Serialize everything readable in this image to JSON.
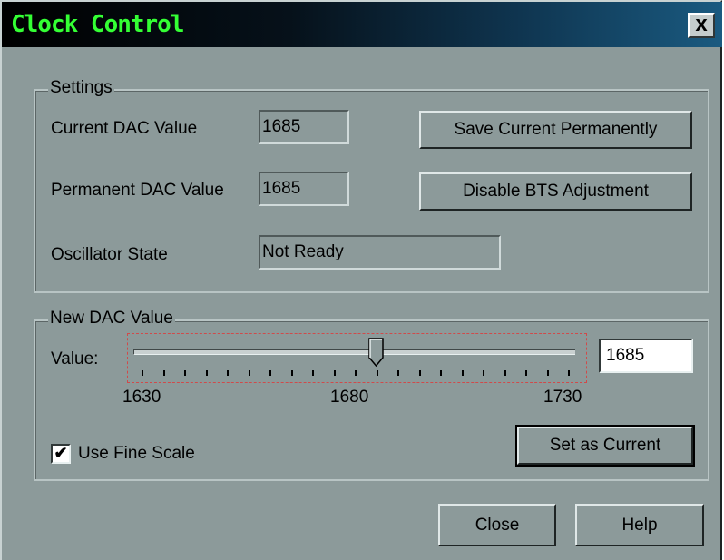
{
  "window": {
    "title": "Clock Control",
    "close_glyph": "x"
  },
  "settings": {
    "legend": "Settings",
    "current_dac_label": "Current DAC Value",
    "current_dac_value": "1685",
    "permanent_dac_label": "Permanent DAC Value",
    "permanent_dac_value": "1685",
    "oscillator_label": "Oscillator State",
    "oscillator_value": "Not Ready",
    "save_button": "Save Current Permanently",
    "disable_button": "Disable BTS Adjustment"
  },
  "new_dac": {
    "legend": "New DAC Value",
    "value_label": "Value:",
    "slider": {
      "min": 1630,
      "max": 1730,
      "value": 1685,
      "tick_count": 21
    },
    "tick_labels": [
      "1630",
      "1680",
      "1730"
    ],
    "input_value": "1685",
    "fine_scale_label": "Use Fine Scale",
    "fine_scale_checked": true,
    "check_glyph": "✔",
    "set_current_button": "Set as Current"
  },
  "footer": {
    "close_button": "Close",
    "help_button": "Help"
  },
  "colors": {
    "window_bg": "#8c9a9a",
    "title_text": "#34ff34",
    "title_gradient_end": "#1a5a80"
  }
}
